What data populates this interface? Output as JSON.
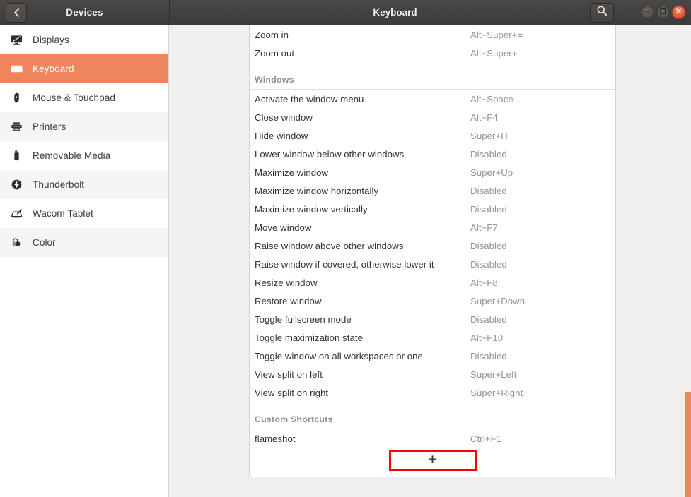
{
  "window": {
    "sidebar_title": "Devices",
    "title": "Keyboard",
    "back_icon": "chevron-left-icon",
    "search_icon": "search-icon",
    "minimize_label": "–",
    "maximize_label": "□",
    "close_label": "×"
  },
  "colors": {
    "accent": "#ef855c",
    "titlebar": "#3c3b39",
    "highlight_box": "#ff0000",
    "close_button": "#d9502a",
    "accel_text": "#949494",
    "section_text": "#90908f"
  },
  "sidebar": {
    "items": [
      {
        "label": "Displays",
        "icon": "display-icon",
        "active": false
      },
      {
        "label": "Keyboard",
        "icon": "keyboard-icon",
        "active": true
      },
      {
        "label": "Mouse & Touchpad",
        "icon": "mouse-icon",
        "active": false
      },
      {
        "label": "Printers",
        "icon": "printer-icon",
        "active": false
      },
      {
        "label": "Removable Media",
        "icon": "usb-drive-icon",
        "active": false
      },
      {
        "label": "Thunderbolt",
        "icon": "thunderbolt-icon",
        "active": false
      },
      {
        "label": "Wacom Tablet",
        "icon": "wacom-tablet-icon",
        "active": false
      },
      {
        "label": "Color",
        "icon": "color-icon",
        "active": false
      }
    ]
  },
  "shortcuts": {
    "rows": [
      {
        "kind": "shortcut",
        "name": "Zoom in",
        "accel": "Alt+Super+="
      },
      {
        "kind": "shortcut",
        "name": "Zoom out",
        "accel": "Alt+Super+-"
      },
      {
        "kind": "section",
        "name": "Windows"
      },
      {
        "kind": "shortcut",
        "name": "Activate the window menu",
        "accel": "Alt+Space"
      },
      {
        "kind": "shortcut",
        "name": "Close window",
        "accel": "Alt+F4"
      },
      {
        "kind": "shortcut",
        "name": "Hide window",
        "accel": "Super+H"
      },
      {
        "kind": "shortcut",
        "name": "Lower window below other windows",
        "accel": "Disabled"
      },
      {
        "kind": "shortcut",
        "name": "Maximize window",
        "accel": "Super+Up"
      },
      {
        "kind": "shortcut",
        "name": "Maximize window horizontally",
        "accel": "Disabled"
      },
      {
        "kind": "shortcut",
        "name": "Maximize window vertically",
        "accel": "Disabled"
      },
      {
        "kind": "shortcut",
        "name": "Move window",
        "accel": "Alt+F7"
      },
      {
        "kind": "shortcut",
        "name": "Raise window above other windows",
        "accel": "Disabled"
      },
      {
        "kind": "shortcut",
        "name": "Raise window if covered, otherwise lower it",
        "accel": "Disabled"
      },
      {
        "kind": "shortcut",
        "name": "Resize window",
        "accel": "Alt+F8"
      },
      {
        "kind": "shortcut",
        "name": "Restore window",
        "accel": "Super+Down"
      },
      {
        "kind": "shortcut",
        "name": "Toggle fullscreen mode",
        "accel": "Disabled"
      },
      {
        "kind": "shortcut",
        "name": "Toggle maximization state",
        "accel": "Alt+F10"
      },
      {
        "kind": "shortcut",
        "name": "Toggle window on all workspaces or one",
        "accel": "Disabled"
      },
      {
        "kind": "shortcut",
        "name": "View split on left",
        "accel": "Super+Left"
      },
      {
        "kind": "shortcut",
        "name": "View split on right",
        "accel": "Super+Right"
      },
      {
        "kind": "section",
        "name": "Custom Shortcuts"
      },
      {
        "kind": "shortcut",
        "name": "flameshot",
        "accel": "Ctrl+F1"
      }
    ],
    "add_button_label": "+"
  }
}
